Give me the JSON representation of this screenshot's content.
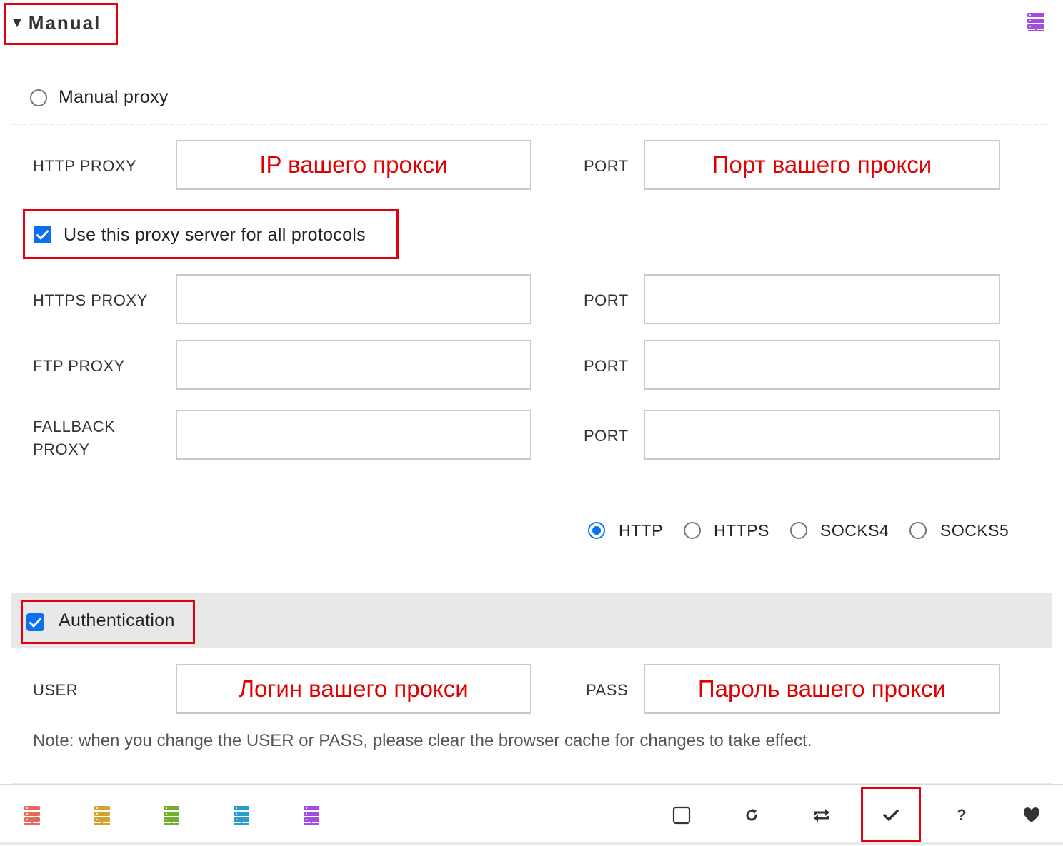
{
  "header": {
    "title": "Manual",
    "collapse_glyph": "▼",
    "icon": "server-icon",
    "icon_color": "#a24ce0"
  },
  "mode": {
    "label": "Manual proxy",
    "selected": false
  },
  "http": {
    "label": "HTTP PROXY",
    "value": "IP вашего прокси",
    "port_label": "PORT",
    "port_value": "Порт вашего прокси"
  },
  "use_all": {
    "label": "Use this proxy server for all protocols",
    "checked": true
  },
  "https": {
    "label": "HTTPS PROXY",
    "value": "",
    "port_label": "PORT",
    "port_value": ""
  },
  "ftp": {
    "label": "FTP PROXY",
    "value": "",
    "port_label": "PORT",
    "port_value": ""
  },
  "fallback": {
    "label_line1": "FALLBACK",
    "label_line2": "PROXY",
    "value": "",
    "port_label": "PORT",
    "port_value": ""
  },
  "protocols": {
    "options": [
      "HTTP",
      "HTTPS",
      "SOCKS4",
      "SOCKS5"
    ],
    "selected": "HTTP"
  },
  "auth": {
    "label": "Authentication",
    "checked": true,
    "user_label": "USER",
    "user_value": "Логин вашего прокси",
    "pass_label": "PASS",
    "pass_value": "Пароль вашего прокси",
    "note": "Note: when you change the USER or PASS, please clear the browser cache for changes to take effect."
  },
  "toolbar": {
    "profile_icons": [
      {
        "name": "server-icon",
        "color": "#e8685a"
      },
      {
        "name": "server-icon",
        "color": "#d4a12a"
      },
      {
        "name": "server-icon",
        "color": "#6fae2f"
      },
      {
        "name": "server-icon",
        "color": "#2b9ad0"
      },
      {
        "name": "server-icon",
        "color": "#a24ce0"
      }
    ],
    "buttons": [
      "checkbox-icon",
      "reload-icon",
      "repeat-icon",
      "check-icon",
      "help-icon",
      "heart-icon"
    ],
    "help_glyph": "?"
  },
  "colors": {
    "annotation_red": "#e0000f",
    "accent_blue": "#0b6ff2",
    "field_text_red": "#e00000"
  }
}
